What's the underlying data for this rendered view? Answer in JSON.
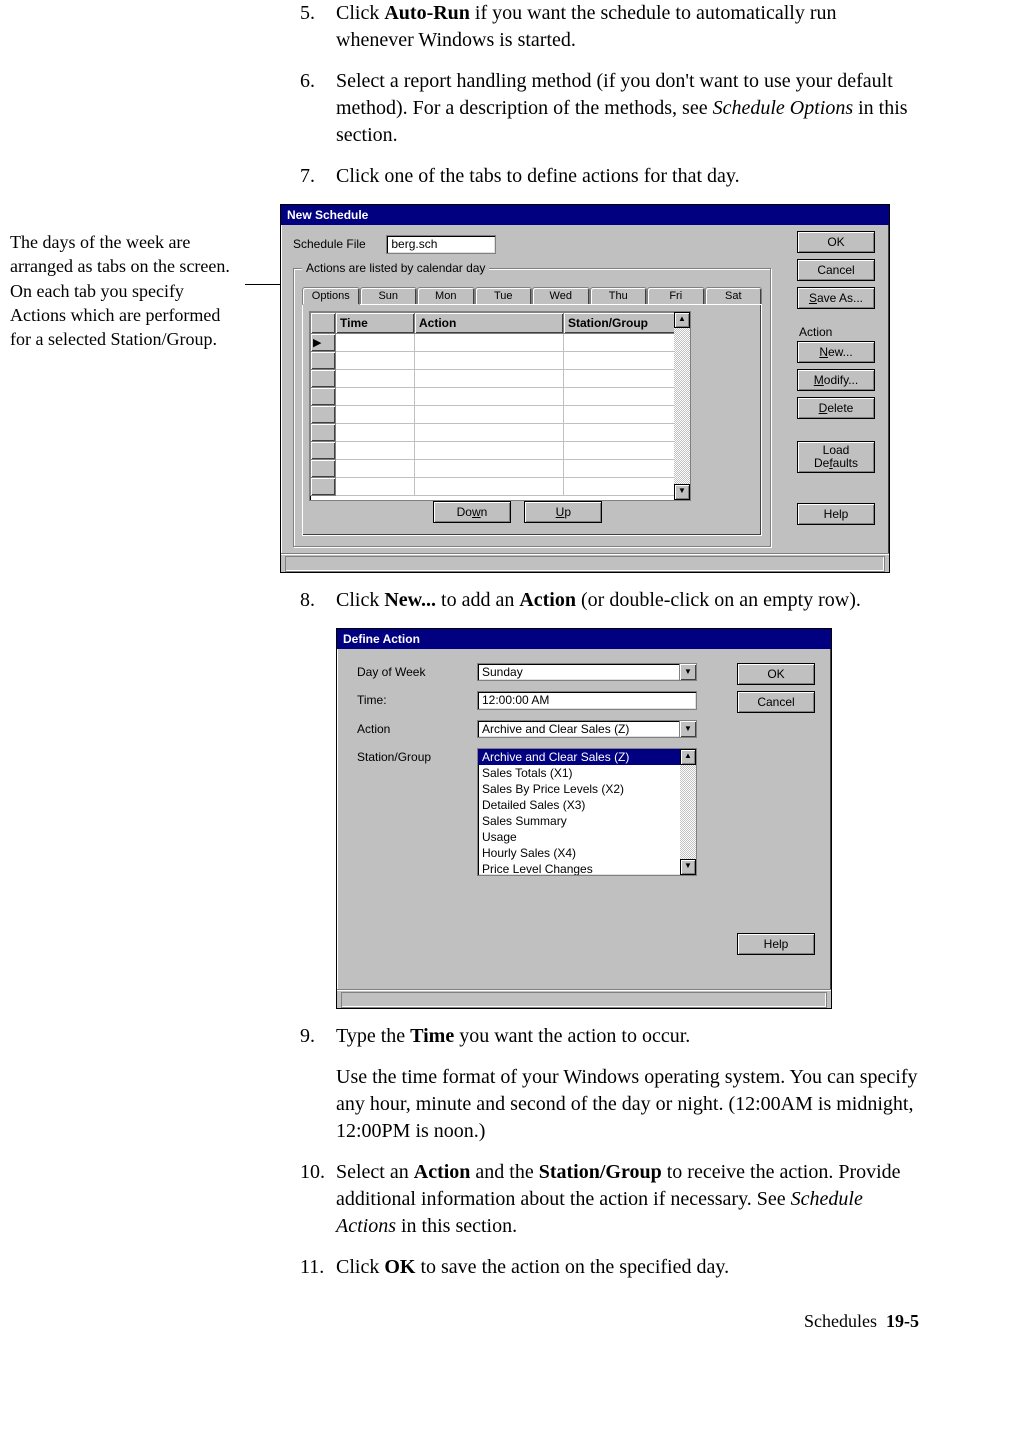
{
  "steps": {
    "s5": {
      "num": "5.",
      "pre": "Click ",
      "bold": "Auto-Run",
      "post": " if you want the schedule to automatically run whenever Windows is started."
    },
    "s6": {
      "num": "6.",
      "pre": "Select a report handling method (if you don't want to use your default method). For a description of the methods, see ",
      "ital": "Schedule Options",
      "post": " in this section."
    },
    "s7": {
      "num": "7.",
      "text": "Click one of the tabs to define actions for that day."
    },
    "s8": {
      "num": "8.",
      "pre": "Click ",
      "b1": "New...",
      "mid": " to add an ",
      "b2": "Action",
      "post": " (or double-click on an empty row)."
    },
    "s9": {
      "num": "9.",
      "pre": "Type the ",
      "b1": "Time",
      "post": " you want the action to occur."
    },
    "s9p": "Use the time format of your Windows operating system. You can specify any hour, minute and second of the day or night. (12:00AM is midnight, 12:00PM is noon.)",
    "s10": {
      "num": "10.",
      "pre": "Select an ",
      "b1": "Action",
      "mid1": " and the ",
      "b2": "Station/Group",
      "mid2": " to receive the action.  Provide additional information about the action if necessary. See ",
      "ital": "Schedule Actions",
      "post": " in this section."
    },
    "s11": {
      "num": "11.",
      "pre": "Click ",
      "b1": "OK",
      "post": " to save the action on the specified day."
    }
  },
  "margin_note": "The days of the week are arranged as tabs on the screen. On each tab you specify Actions which are performed for a selected Station/Group.",
  "dlg1": {
    "title": "New Schedule",
    "schedule_file_label": "Schedule File",
    "schedule_file_value": "berg.sch",
    "group_legend": "Actions are listed by calendar day",
    "tabs": [
      "Options",
      "Sun",
      "Mon",
      "Tue",
      "Wed",
      "Thu",
      "Fri",
      "Sat"
    ],
    "grid_headers": {
      "time": "Time",
      "action": "Action",
      "station": "Station/Group"
    },
    "btn_down": "Down",
    "btn_down_u": "w",
    "btn_up": "Up",
    "btn_up_u": "U",
    "btn_ok": "OK",
    "btn_cancel": "Cancel",
    "btn_saveas": "Save As...",
    "btn_saveas_u": "S",
    "section_action": "Action",
    "btn_new": "New...",
    "btn_new_u": "N",
    "btn_modify": "Modify...",
    "btn_modify_u": "M",
    "btn_delete": "Delete",
    "btn_delete_u": "D",
    "btn_loaddef_l1": "Load",
    "btn_loaddef_l2": "Defaults",
    "btn_loaddef_u": "f",
    "btn_help": "Help"
  },
  "dlg2": {
    "title": "Define Action",
    "lbl_day": "Day of Week",
    "val_day": "Sunday",
    "lbl_time": "Time:",
    "val_time": "12:00:00 AM",
    "lbl_action": "Action",
    "val_action": "Archive and Clear Sales (Z)",
    "lbl_station": "Station/Group",
    "list": [
      "Archive and Clear Sales (Z)",
      "Sales Totals (X1)",
      "Sales By Price Levels (X2)",
      "Detailed Sales (X3)",
      "Sales Summary",
      "Usage",
      "Hourly Sales (X4)",
      "Price Level Changes"
    ],
    "btn_ok": "OK",
    "btn_cancel": "Cancel",
    "btn_help": "Help"
  },
  "footer": {
    "label": "Schedules",
    "page": "19-5"
  }
}
